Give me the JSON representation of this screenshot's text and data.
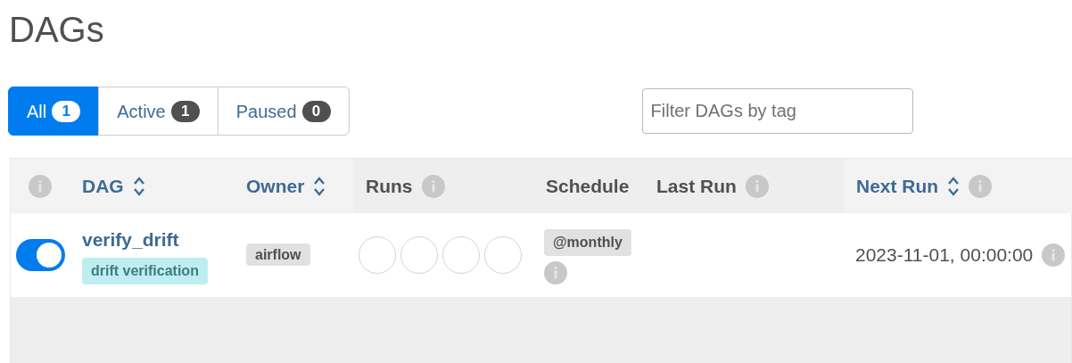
{
  "title": "DAGs",
  "filters": [
    {
      "label": "All",
      "count": "1",
      "selected": true
    },
    {
      "label": "Active",
      "count": "1",
      "selected": false
    },
    {
      "label": "Paused",
      "count": "0",
      "selected": false
    }
  ],
  "tag_filter": {
    "placeholder": "Filter DAGs by tag"
  },
  "table": {
    "columns": [
      {
        "kind": "info"
      },
      {
        "label": "DAG",
        "sortable": true,
        "info": false
      },
      {
        "label": "Owner",
        "sortable": true,
        "info": false
      },
      {
        "label": "Runs",
        "sortable": false,
        "info": true
      },
      {
        "label": "Schedule",
        "sortable": false,
        "info": false
      },
      {
        "label": "Last Run",
        "sortable": false,
        "info": true
      },
      {
        "label": "Next Run",
        "sortable": true,
        "info": true
      }
    ],
    "rows": [
      {
        "on": true,
        "dag": "verify_drift",
        "tag": "drift verification",
        "owner": "airflow",
        "runs": [
          {
            "kind": "empty"
          },
          {
            "kind": "empty"
          },
          {
            "kind": "empty"
          },
          {
            "kind": "empty"
          }
        ],
        "schedule": "@monthly",
        "next_run": "2023-11-01, 00:00:00"
      }
    ]
  }
}
